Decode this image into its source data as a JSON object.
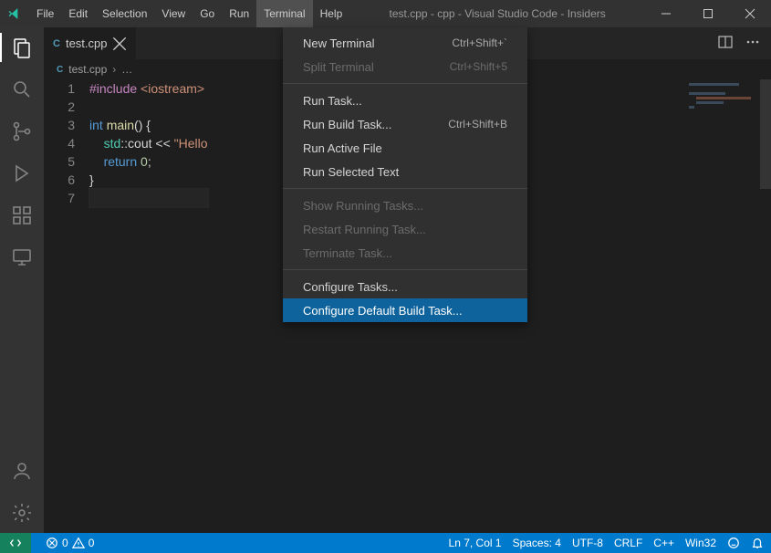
{
  "window": {
    "title": "test.cpp - cpp - Visual Studio Code - Insiders"
  },
  "menubar": {
    "items": [
      "File",
      "Edit",
      "Selection",
      "View",
      "Go",
      "Run",
      "Terminal",
      "Help"
    ],
    "active_index": 6
  },
  "tabs": {
    "active": {
      "filename": "test.cpp"
    }
  },
  "breadcrumb": {
    "filename": "test.cpp",
    "ellipsis": "…"
  },
  "code": {
    "lines": [
      {
        "n": "1",
        "segs": [
          {
            "t": "#include ",
            "c": "tok-pp"
          },
          {
            "t": "<iostream>",
            "c": "tok-inc"
          }
        ]
      },
      {
        "n": "2",
        "segs": []
      },
      {
        "n": "3",
        "segs": [
          {
            "t": "int ",
            "c": "tok-kw"
          },
          {
            "t": "main",
            "c": "tok-fn"
          },
          {
            "t": "() {",
            "c": ""
          }
        ]
      },
      {
        "n": "4",
        "segs": [
          {
            "t": "    ",
            "c": ""
          },
          {
            "t": "std",
            "c": "tok-ns"
          },
          {
            "t": "::",
            "c": ""
          },
          {
            "t": "cout",
            "c": ""
          },
          {
            "t": " << ",
            "c": ""
          },
          {
            "t": "\"Hello",
            "c": "tok-str"
          }
        ]
      },
      {
        "n": "5",
        "segs": [
          {
            "t": "    ",
            "c": ""
          },
          {
            "t": "return ",
            "c": "tok-kw"
          },
          {
            "t": "0",
            "c": "tok-num"
          },
          {
            "t": ";",
            "c": ""
          }
        ]
      },
      {
        "n": "6",
        "segs": [
          {
            "t": "}",
            "c": ""
          }
        ]
      },
      {
        "n": "7",
        "segs": [],
        "cursor": true
      }
    ]
  },
  "dropdown": {
    "groups": [
      [
        {
          "label": "New Terminal",
          "shortcut": "Ctrl+Shift+`",
          "disabled": false
        },
        {
          "label": "Split Terminal",
          "shortcut": "Ctrl+Shift+5",
          "disabled": true
        }
      ],
      [
        {
          "label": "Run Task...",
          "shortcut": "",
          "disabled": false
        },
        {
          "label": "Run Build Task...",
          "shortcut": "Ctrl+Shift+B",
          "disabled": false
        },
        {
          "label": "Run Active File",
          "shortcut": "",
          "disabled": false
        },
        {
          "label": "Run Selected Text",
          "shortcut": "",
          "disabled": false
        }
      ],
      [
        {
          "label": "Show Running Tasks...",
          "shortcut": "",
          "disabled": true
        },
        {
          "label": "Restart Running Task...",
          "shortcut": "",
          "disabled": true
        },
        {
          "label": "Terminate Task...",
          "shortcut": "",
          "disabled": true
        }
      ],
      [
        {
          "label": "Configure Tasks...",
          "shortcut": "",
          "disabled": false
        },
        {
          "label": "Configure Default Build Task...",
          "shortcut": "",
          "disabled": false,
          "selected": true
        }
      ]
    ]
  },
  "status": {
    "errors": "0",
    "warnings": "0",
    "line_col": "Ln 7, Col 1",
    "spaces": "Spaces: 4",
    "encoding": "UTF-8",
    "eol": "CRLF",
    "language": "C++",
    "target": "Win32"
  }
}
